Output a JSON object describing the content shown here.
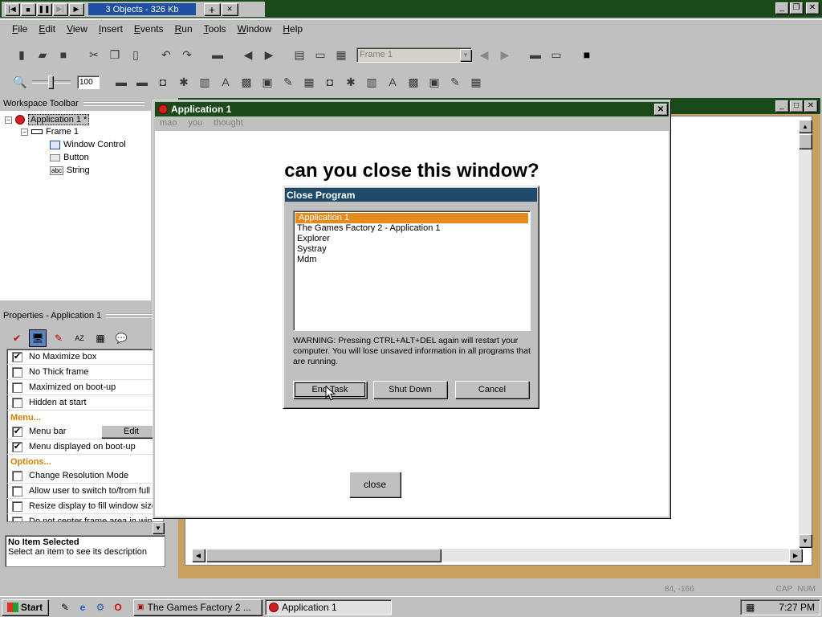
{
  "titlebar": {
    "title": "3 Objects - 326 Kb",
    "controls": [
      "|◀",
      "■",
      "❚❚",
      "▶|",
      "▶"
    ],
    "plus": "+",
    "close": "✕",
    "win_min": "_",
    "win_max": "❐",
    "win_close": "✕"
  },
  "menu": [
    "File",
    "Edit",
    "View",
    "Insert",
    "Events",
    "Run",
    "Tools",
    "Window",
    "Help"
  ],
  "toolbar": {
    "frame_select": "Frame 1",
    "zoom_value": "100"
  },
  "workspace": {
    "header": "Workspace Toolbar",
    "tree": [
      {
        "label": "Application 1 *",
        "expander": "−",
        "icon": "app-icon"
      },
      {
        "label": "Frame 1",
        "expander": "−",
        "icon": "frame-icon"
      },
      {
        "label": "Window Control",
        "icon": "window-control-icon"
      },
      {
        "label": "Button",
        "icon": "button-object-icon"
      },
      {
        "label": "String",
        "icon": "string-object-icon"
      }
    ],
    "string_badge": "abc"
  },
  "properties": {
    "header": "Properties - Application 1",
    "tabs": [
      "✔",
      "🖥",
      "✎",
      "AZ",
      "▦",
      "💬"
    ],
    "rows": [
      {
        "type": "check",
        "label": "No Maximize box",
        "checked": true
      },
      {
        "type": "check",
        "label": "No Thick frame",
        "checked": false
      },
      {
        "type": "check",
        "label": "Maximized on boot-up",
        "checked": false
      },
      {
        "type": "check",
        "label": "Hidden at start",
        "checked": false
      },
      {
        "type": "section",
        "label": "Menu..."
      },
      {
        "type": "check",
        "label": "Menu bar",
        "checked": true,
        "button": "Edit"
      },
      {
        "type": "check",
        "label": "Menu displayed on boot-up",
        "checked": true
      },
      {
        "type": "section",
        "label": "Options..."
      },
      {
        "type": "check",
        "label": "Change Resolution Mode",
        "checked": false
      },
      {
        "type": "check",
        "label": "Allow user to switch to/from full",
        "checked": false
      },
      {
        "type": "check",
        "label": "Resize display to fill window size",
        "checked": false
      },
      {
        "type": "check",
        "label": "Do not center frame area in win",
        "checked": false
      }
    ],
    "desc_title": "No Item Selected",
    "desc_text": "Select an item to see its description"
  },
  "appwin": {
    "title": "Application 1",
    "menu": [
      "mao",
      "you",
      "thought"
    ],
    "heading": "can you close this window?",
    "close_button": "close"
  },
  "dialog": {
    "title": "Close Program",
    "processes": [
      "Application 1",
      "The Games Factory 2 - Application 1",
      "Explorer",
      "Systray",
      "Mdm"
    ],
    "selected_index": 0,
    "warning": "WARNING: Pressing CTRL+ALT+DEL again will restart your computer. You will lose unsaved information in all programs that are running.",
    "end_task": "End Task",
    "shut_down": "Shut Down",
    "cancel": "Cancel"
  },
  "statusbar": {
    "coords": "84, -166",
    "caps": "CAP",
    "num": "NUM"
  },
  "taskbar": {
    "start": "Start",
    "tasks": [
      "The Games Factory 2 ...",
      "Application 1"
    ],
    "time": "7:27 PM"
  }
}
